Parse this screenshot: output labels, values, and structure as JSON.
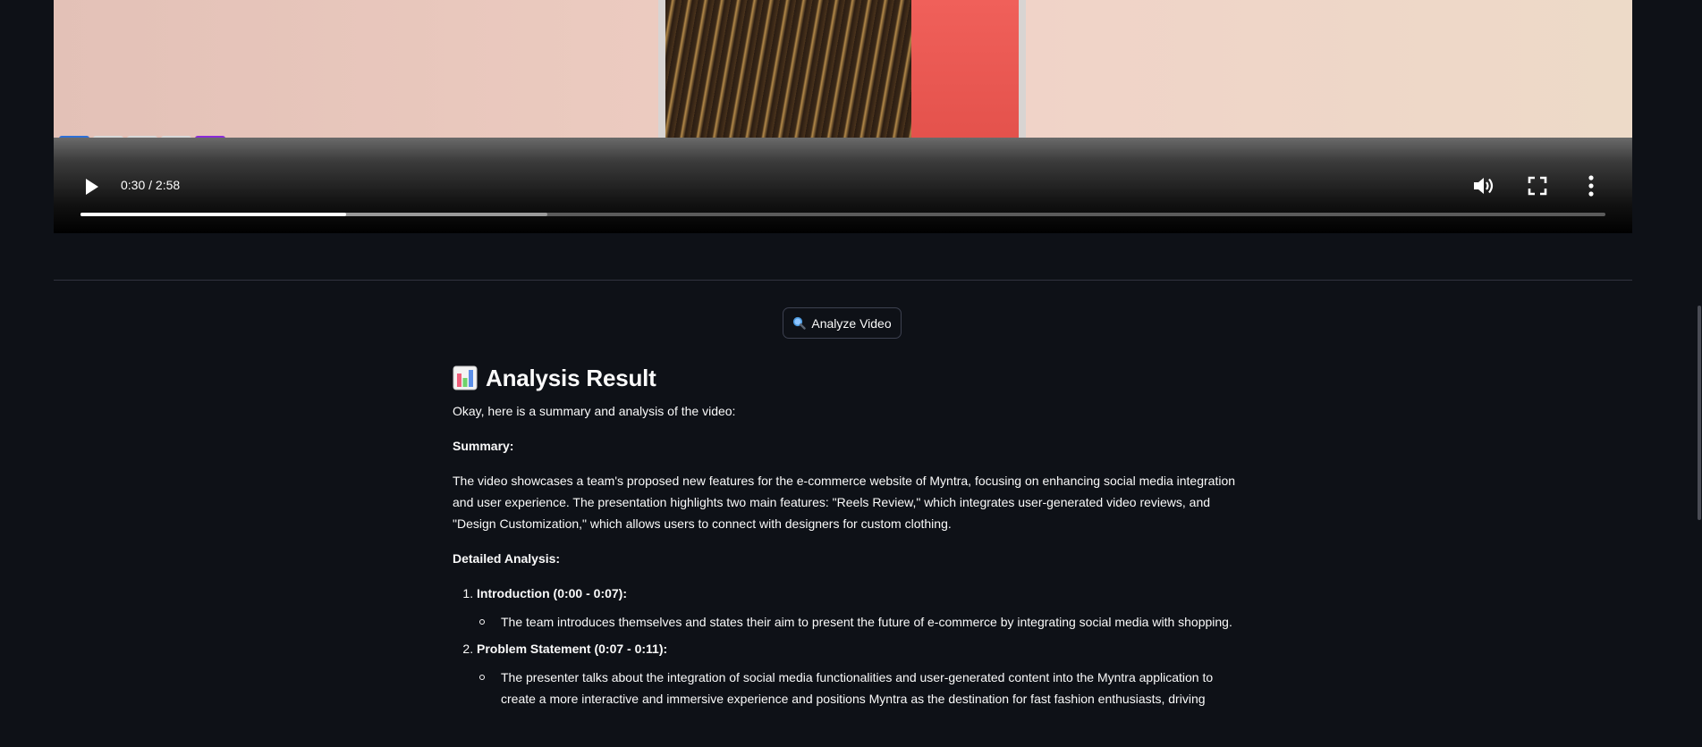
{
  "player": {
    "time_display": "0:30 / 2:58",
    "progress_fraction": 0.174,
    "buffered_fraction": 0.306,
    "play_icon": "play-icon",
    "volume_icon": "volume-icon",
    "fullscreen_icon": "fullscreen-icon",
    "more_icon": "more-options-icon"
  },
  "analyze_button": {
    "icon": "magnifier-icon",
    "label": "Analyze Video"
  },
  "result": {
    "icon": "bar-chart-icon",
    "title": "Analysis Result",
    "intro": "Okay, here is a summary and analysis of the video:",
    "summary_heading": "Summary:",
    "summary_text": "The video showcases a team's proposed new features for the e-commerce website of Myntra, focusing on enhancing social media integration and user experience. The presentation highlights two main features: \"Reels Review,\" which integrates user-generated video reviews, and \"Design Customization,\" which allows users to connect with designers for custom clothing.",
    "detailed_heading": "Detailed Analysis:",
    "sections": [
      {
        "title": "Introduction (0:00 - 0:07):",
        "points": [
          "The team introduces themselves and states their aim to present the future of e-commerce by integrating social media with shopping."
        ]
      },
      {
        "title": "Problem Statement (0:07 - 0:11):",
        "points": [
          "The presenter talks about the integration of social media functionalities and user-generated content into the Myntra application to create a more interactive and immersive experience and positions Myntra as the destination for fast fashion enthusiasts, driving"
        ]
      }
    ]
  },
  "colors": {
    "background": "#0e1117",
    "text": "#fafafa",
    "border": "#3d4150",
    "divider": "#31333f"
  }
}
